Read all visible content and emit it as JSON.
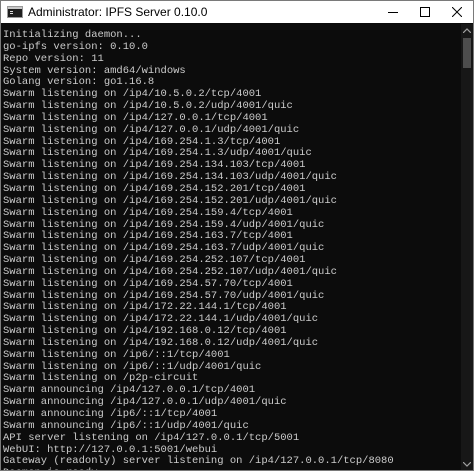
{
  "window": {
    "title": "Administrator:  IPFS Server 0.10.0",
    "controls": [
      "minimize",
      "maximize",
      "close"
    ]
  },
  "console": {
    "lines": [
      "Initializing daemon...",
      "go-ipfs version: 0.10.0",
      "Repo version: 11",
      "System version: amd64/windows",
      "Golang version: go1.16.8",
      "Swarm listening on /ip4/10.5.0.2/tcp/4001",
      "Swarm listening on /ip4/10.5.0.2/udp/4001/quic",
      "Swarm listening on /ip4/127.0.0.1/tcp/4001",
      "Swarm listening on /ip4/127.0.0.1/udp/4001/quic",
      "Swarm listening on /ip4/169.254.1.3/tcp/4001",
      "Swarm listening on /ip4/169.254.1.3/udp/4001/quic",
      "Swarm listening on /ip4/169.254.134.103/tcp/4001",
      "Swarm listening on /ip4/169.254.134.103/udp/4001/quic",
      "Swarm listening on /ip4/169.254.152.201/tcp/4001",
      "Swarm listening on /ip4/169.254.152.201/udp/4001/quic",
      "Swarm listening on /ip4/169.254.159.4/tcp/4001",
      "Swarm listening on /ip4/169.254.159.4/udp/4001/quic",
      "Swarm listening on /ip4/169.254.163.7/tcp/4001",
      "Swarm listening on /ip4/169.254.163.7/udp/4001/quic",
      "Swarm listening on /ip4/169.254.252.107/tcp/4001",
      "Swarm listening on /ip4/169.254.252.107/udp/4001/quic",
      "Swarm listening on /ip4/169.254.57.70/tcp/4001",
      "Swarm listening on /ip4/169.254.57.70/udp/4001/quic",
      "Swarm listening on /ip4/172.22.144.1/tcp/4001",
      "Swarm listening on /ip4/172.22.144.1/udp/4001/quic",
      "Swarm listening on /ip4/192.168.0.12/tcp/4001",
      "Swarm listening on /ip4/192.168.0.12/udp/4001/quic",
      "Swarm listening on /ip6/::1/tcp/4001",
      "Swarm listening on /ip6/::1/udp/4001/quic",
      "Swarm listening on /p2p-circuit",
      "Swarm announcing /ip4/127.0.0.1/tcp/4001",
      "Swarm announcing /ip4/127.0.0.1/udp/4001/quic",
      "Swarm announcing /ip6/::1/tcp/4001",
      "Swarm announcing /ip6/::1/udp/4001/quic",
      "API server listening on /ip4/127.0.0.1/tcp/5001",
      "WebUI: http://127.0.0.1:5001/webui",
      "Gateway (readonly) server listening on /ip4/127.0.0.1/tcp/8080",
      "Daemon is ready"
    ]
  },
  "colors": {
    "console_bg": "#0c0c0c",
    "console_text": "#cccccc",
    "titlebar_bg": "#ffffff"
  }
}
